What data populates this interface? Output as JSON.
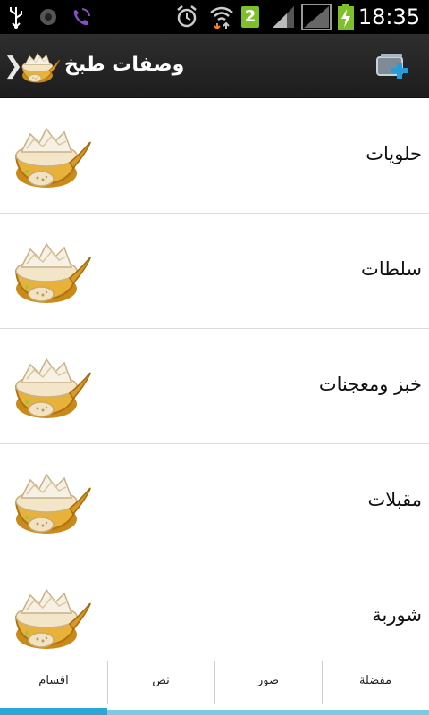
{
  "status_bar": {
    "time": "18:35",
    "notification_count": "2",
    "icons": [
      "usb-icon",
      "voicemail-icon",
      "viber-icon",
      "alarm-icon",
      "wifi-icon",
      "sim-badge-icon",
      "signal-icon",
      "signal-empty-icon",
      "battery-charging-icon"
    ]
  },
  "action_bar": {
    "title": "وصفات طبخ",
    "back_icon": "chevron-right-icon",
    "logo_icon": "cooking-bowl-icon",
    "action_icon": "add-to-home-icon"
  },
  "categories": [
    {
      "label": "حلويات",
      "icon": "cooking-bowl-icon"
    },
    {
      "label": "سلطات",
      "icon": "cooking-bowl-icon"
    },
    {
      "label": "خبز ومعجنات",
      "icon": "cooking-bowl-icon"
    },
    {
      "label": "مقبلات",
      "icon": "cooking-bowl-icon"
    },
    {
      "label": "شوربة",
      "icon": "cooking-bowl-icon"
    }
  ],
  "tabs": [
    {
      "label": "اقسام",
      "active": true
    },
    {
      "label": "نص",
      "active": false
    },
    {
      "label": "صور",
      "active": false
    },
    {
      "label": "مفضلة",
      "active": false
    }
  ],
  "colors": {
    "action_bar": "#262626",
    "tab_active": "#29a7d6",
    "tab_inactive": "#7cc9e3",
    "battery": "#7fbf2a"
  }
}
